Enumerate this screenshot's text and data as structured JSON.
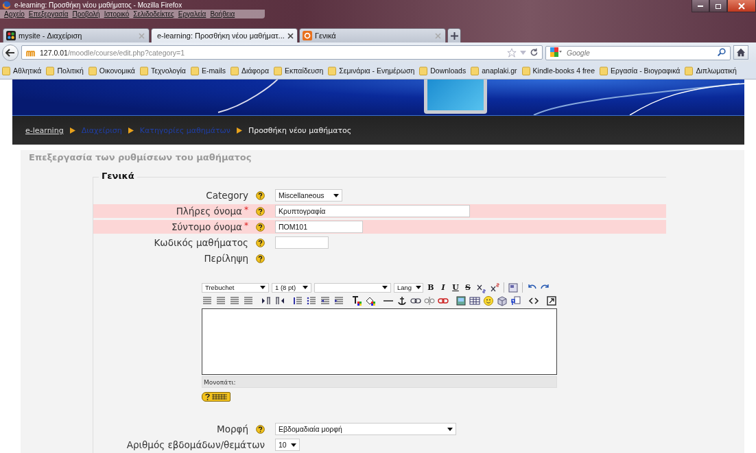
{
  "window": {
    "title": "e-learning: Προσθήκη νέου μαθήματος - Mozilla Firefox"
  },
  "menu": [
    "Αρχείο",
    "Επεξεργασία",
    "Προβολή",
    "Ιστορικό",
    "Σελιδοδείκτες",
    "Εργαλεία",
    "Βοήθεια"
  ],
  "tabs": [
    {
      "label": "mysite - Διαχείριση",
      "selected": false,
      "kind": "joomla"
    },
    {
      "label": "e-learning: Προσθήκη νέου μαθήματ...",
      "selected": true,
      "kind": "moodle"
    },
    {
      "label": "Γενικά",
      "selected": false,
      "kind": "joomla-orange"
    }
  ],
  "address_bar": {
    "host": "127.0.01",
    "path": "/moodle/course/edit.php?category=1"
  },
  "search": {
    "placeholder": "Google"
  },
  "bookmarks": [
    "Αθλητικά",
    "Πολιτική",
    "Οικονομικά",
    "Τεχνολογία",
    "E-mails",
    "Διάφορα",
    "Εκπαίδευση",
    "Σεμινάρια - Ενημέρωση",
    "Downloads",
    "anaplaki.gr",
    "Kindle-books 4 free",
    "Εργασία - Βιογραφικά",
    "Διπλωματική"
  ],
  "breadcrumb": [
    {
      "label": "e-learning",
      "kind": "home"
    },
    {
      "label": "Διαχείριση",
      "kind": "link"
    },
    {
      "label": "Κατηγορίες μαθημάτων",
      "kind": "link"
    },
    {
      "label": "Προσθήκη νέου μαθήματος",
      "kind": "current"
    }
  ],
  "form": {
    "heading": "Επεξεργασία των ρυθμίσεων του μαθήματος",
    "legend": "Γενικά",
    "rows": [
      {
        "label": "Category",
        "required": false,
        "help": true,
        "kind": "select",
        "value": "Miscellaneous"
      },
      {
        "label": "Πλήρες όνομα",
        "marker": "*",
        "required": true,
        "help": true,
        "kind": "text",
        "value": "Κρυπτογραφία"
      },
      {
        "label": "Σύντομο όνομα",
        "marker": "*",
        "required": true,
        "help": true,
        "kind": "text",
        "value": "ΠΟΜ101"
      },
      {
        "label": "Κωδικός μαθήματος",
        "required": false,
        "help": true,
        "kind": "text"
      },
      {
        "label": "Περίληψη",
        "required": false,
        "help": true,
        "kind": "none"
      }
    ],
    "editor": {
      "selects": [
        "Trebuchet",
        "1 (8 pt)",
        "Lang"
      ],
      "format_buttons": [
        "B",
        "I",
        "U",
        "S"
      ],
      "path_label": "Μονοπάτι:"
    },
    "rows_after": [
      {
        "label": "Μορφή",
        "help": true,
        "kind": "select",
        "value": "Εβδομαδιαία μορφή"
      },
      {
        "label": "Αριθμός εβδομάδων/θεμάτων",
        "help": false,
        "kind": "select",
        "value": "10"
      }
    ]
  }
}
